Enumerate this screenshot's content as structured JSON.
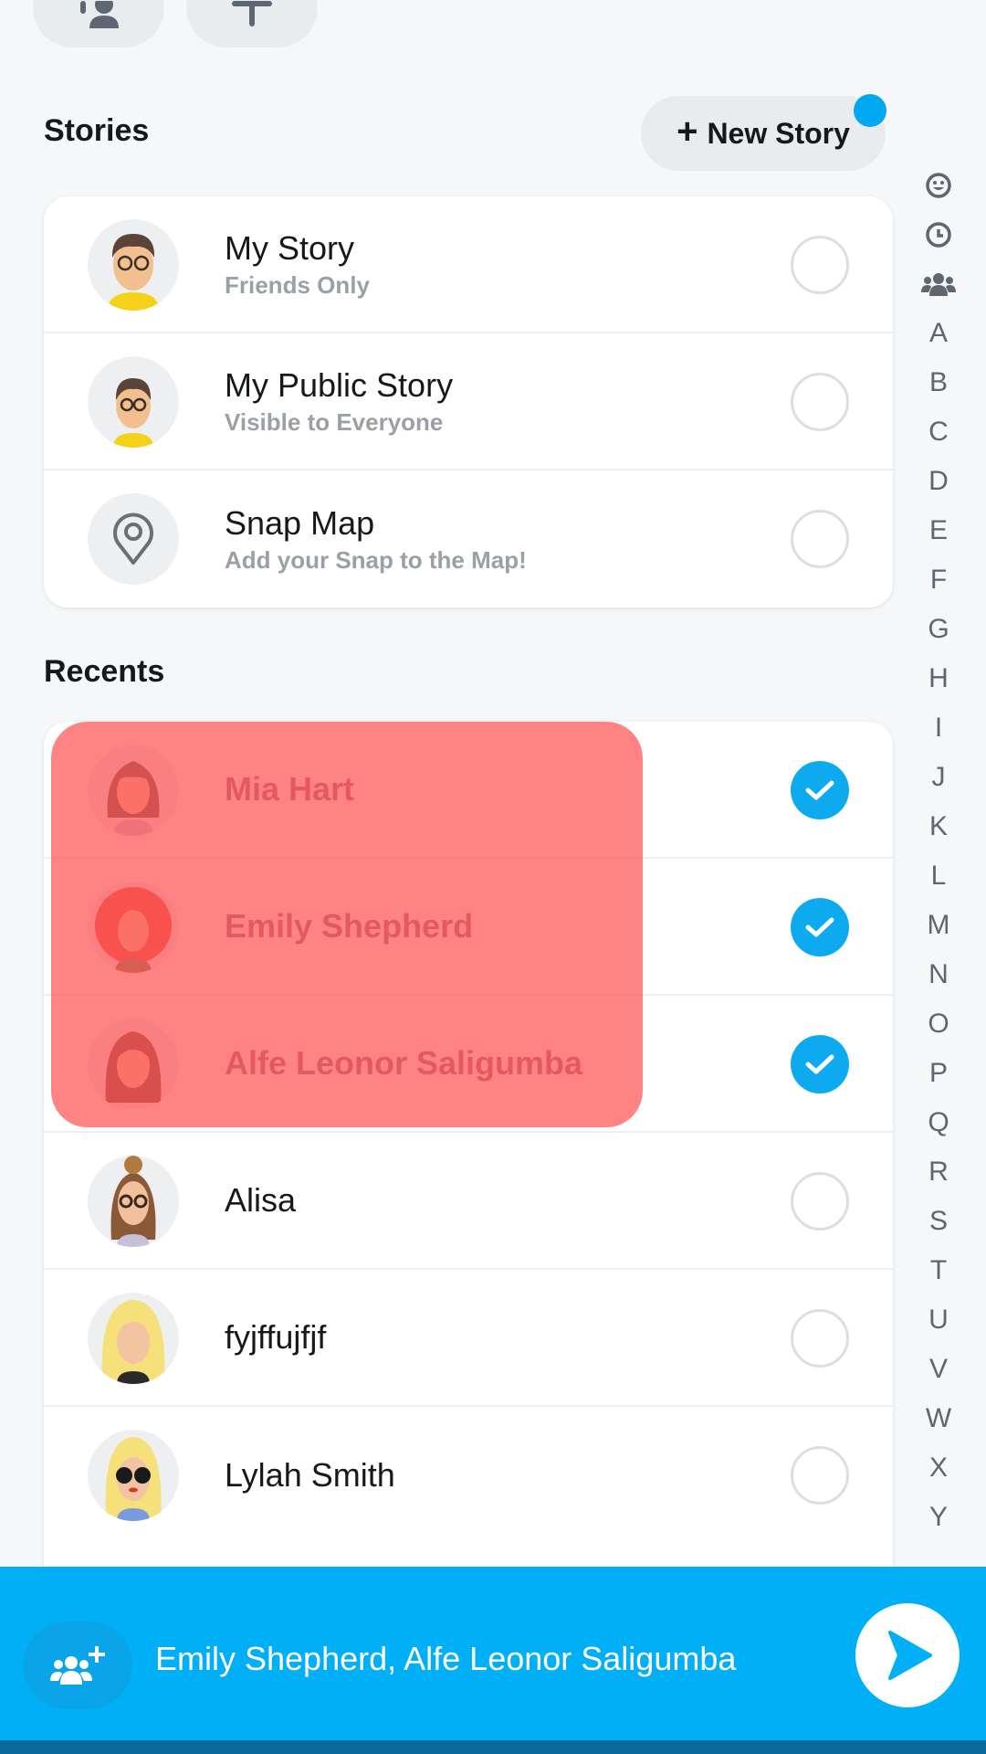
{
  "top_actions": {
    "add_friend_icon": "add-friend-icon",
    "add_icon": "plus-icon"
  },
  "stories": {
    "title": "Stories",
    "new_story_label": "New Story",
    "new_story_badge_color": "#00a8f0",
    "items": [
      {
        "name": "My Story",
        "subtitle": "Friends Only",
        "selected": false
      },
      {
        "name": "My Public Story",
        "subtitle": "Visible to Everyone",
        "selected": false
      },
      {
        "name": "Snap Map",
        "subtitle": "Add your Snap to the Map!",
        "selected": false
      }
    ]
  },
  "recents": {
    "title": "Recents",
    "items": [
      {
        "name": "Mia Hart",
        "selected": true
      },
      {
        "name": "Emily Shepherd",
        "selected": true
      },
      {
        "name": "Alfe Leonor Saligumba",
        "selected": true
      },
      {
        "name": "Alisa",
        "selected": false
      },
      {
        "name": "fyjffujfjf",
        "selected": false
      },
      {
        "name": "Lylah Smith",
        "selected": false
      }
    ]
  },
  "alpha_index": {
    "icons": [
      "smiley-icon",
      "clock-icon",
      "group-icon"
    ],
    "letters": [
      "A",
      "B",
      "C",
      "D",
      "E",
      "F",
      "G",
      "H",
      "I",
      "J",
      "K",
      "L",
      "M",
      "N",
      "O",
      "P",
      "Q",
      "R",
      "S",
      "T",
      "U",
      "V",
      "W",
      "X",
      "Y"
    ]
  },
  "send_bar": {
    "recipients_text": "Emily Shepherd, Alfe Leonor Saligumba",
    "accent_color": "#00aff6"
  }
}
